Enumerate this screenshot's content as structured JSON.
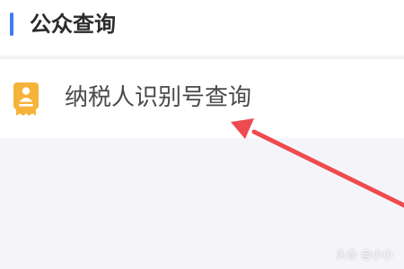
{
  "colors": {
    "accent": "#3d7cf5",
    "icon": "#f6b33a",
    "arrow": "#ee4b50"
  },
  "section": {
    "title": "公众查询"
  },
  "query_item": {
    "icon": "taxpayer-card-icon",
    "label": "纳税人识别号查询"
  },
  "annotation": {
    "icon": "red-arrow-icon"
  },
  "watermark": {
    "text": "头条 @小小"
  }
}
